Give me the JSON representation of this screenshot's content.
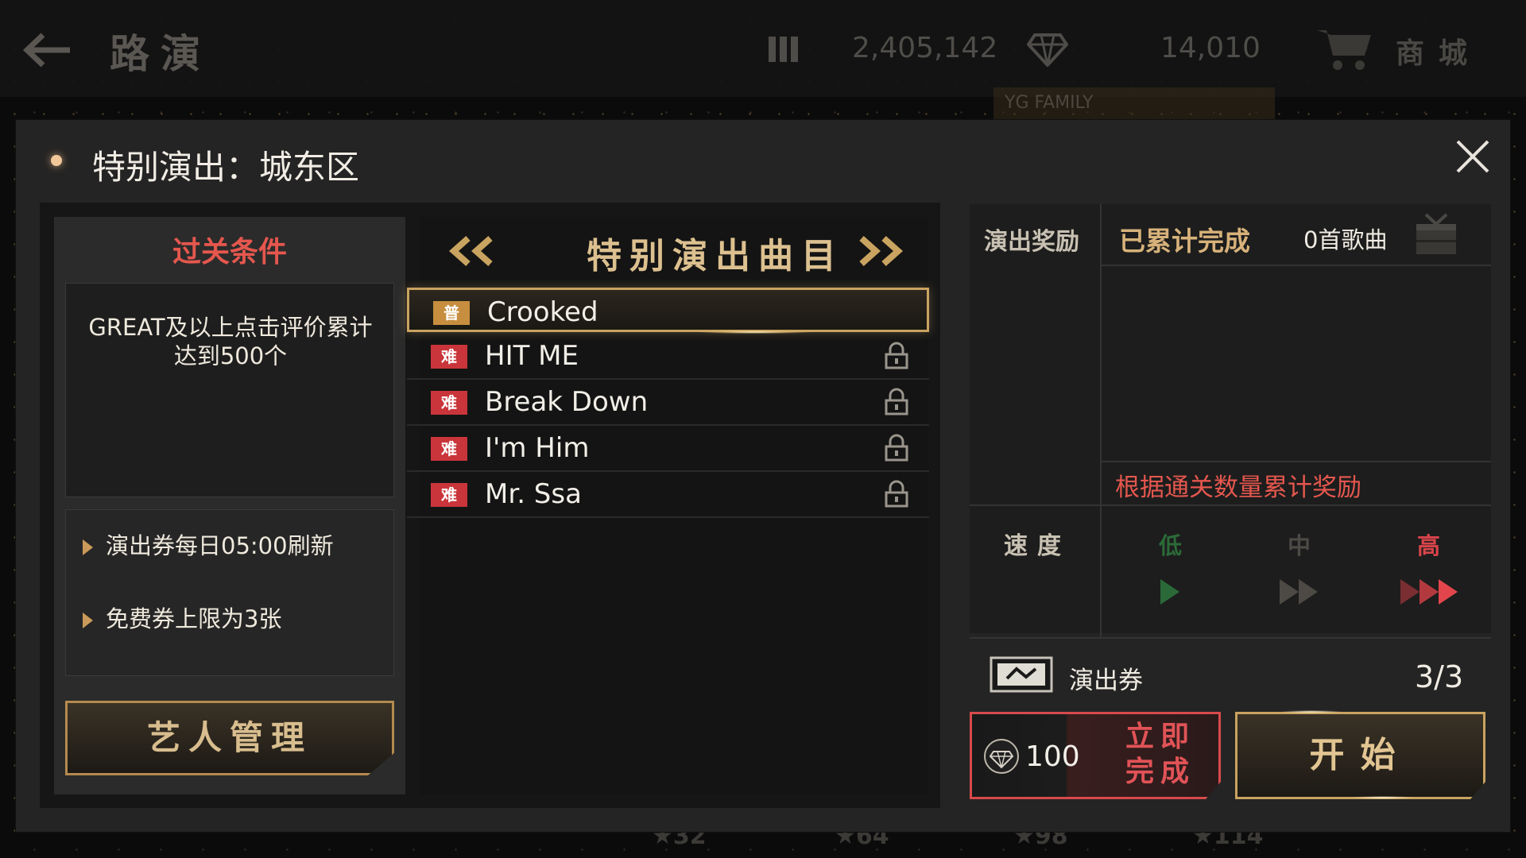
{
  "topbar": {
    "title": "路演",
    "stat_1": "2,405,142",
    "stat_2": "14,010",
    "shop_label": "商城",
    "behind_text": "YG FAMILY",
    "icons": [
      "back-arrow-icon",
      "bars-icon",
      "diamond-icon",
      "cart-icon"
    ]
  },
  "background": {
    "stars": [
      "★32",
      "★64",
      "★98",
      "★114"
    ]
  },
  "modal": {
    "title": "特别演出：城东区"
  },
  "conditions": {
    "title": "过关条件",
    "text": "GREAT及以上点击评价累计达到500个",
    "notes": [
      "演出券每日05:00刷新",
      "免费券上限为3张"
    ],
    "artist_button": "艺人管理"
  },
  "songs": {
    "header": "特别演出曲目",
    "items": [
      {
        "badge": "普",
        "difficulty": "normal",
        "name": "Crooked",
        "locked": false,
        "selected": true
      },
      {
        "badge": "难",
        "difficulty": "hard",
        "name": "HIT ME",
        "locked": true,
        "selected": false
      },
      {
        "badge": "难",
        "difficulty": "hard",
        "name": "Break Down",
        "locked": true,
        "selected": false
      },
      {
        "badge": "难",
        "difficulty": "hard",
        "name": "I'm Him",
        "locked": true,
        "selected": false
      },
      {
        "badge": "难",
        "difficulty": "hard",
        "name": "Mr. Ssa",
        "locked": true,
        "selected": false
      }
    ]
  },
  "reward": {
    "label": "演出奖励",
    "accumulated_label": "已累计完成",
    "count_text": "0首歌曲",
    "note": "根据通关数量累计奖励"
  },
  "speed": {
    "label": "速度",
    "low": "低",
    "mid": "中",
    "high": "高",
    "selected": "high"
  },
  "ticket": {
    "label": "演出券",
    "count": "3/3"
  },
  "actions": {
    "instant_cost": "100",
    "instant_label_1": "立即",
    "instant_label_2": "完成",
    "start_label": "开始"
  },
  "colors": {
    "accent_gold": "#c9a360",
    "alert_red": "#e5574e",
    "speed_low_green": "#2b6a38"
  }
}
